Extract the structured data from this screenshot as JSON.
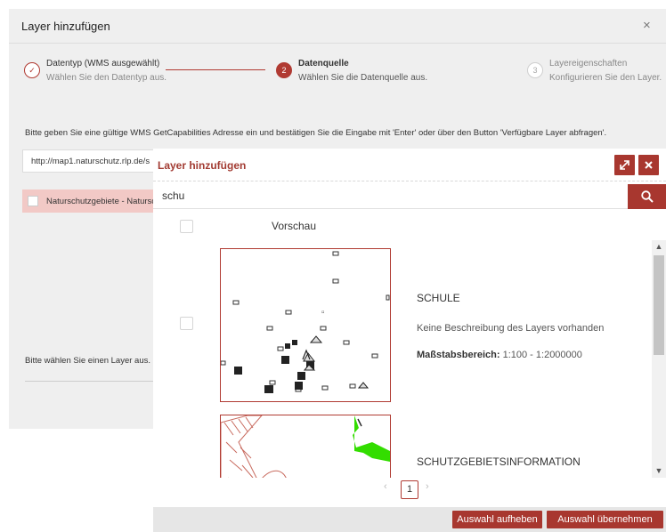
{
  "background_dialog": {
    "title": "Layer hinzufügen",
    "close_glyph": "×",
    "steps": [
      {
        "number": "✓",
        "title": "Datentyp (WMS ausgewählt)",
        "description": "Wählen Sie den Datentyp aus.",
        "state": "done"
      },
      {
        "number": "2",
        "title": "Datenquelle",
        "description": "Wählen Sie die Datenquelle aus.",
        "state": "active"
      },
      {
        "number": "3",
        "title": "Layereigenschaften",
        "description": "Konfigurieren Sie den Layer.",
        "state": "pending"
      }
    ],
    "instruction": "Bitte geben Sie eine gültige WMS GetCapabilities Adresse ein und bestätigen Sie die Eingabe mit 'Enter' oder über den Button 'Verfügbare Layer abfragen'.",
    "url_value": "http://map1.naturschutz.rlp.de/s",
    "layer_row_label": "Naturschutzgebiete - Natursc",
    "choose_prompt": "Bitte wählen Sie einen Layer aus."
  },
  "dialog": {
    "title": "Layer hinzufügen",
    "expand_icon": "expand-icon",
    "close_icon": "close-icon",
    "search": {
      "value": "schu",
      "icon": "search-icon"
    },
    "column_header": "Vorschau",
    "results": [
      {
        "name": "SCHULE",
        "description": "Keine Beschreibung des Layers vorhanden",
        "scale_label": "Maßstabsbereich:",
        "scale_value": "1:100 - 1:2000000"
      },
      {
        "name": "SCHUTZGEBIETSINFORMATION"
      }
    ],
    "pagination": {
      "prev": "‹",
      "current": "1",
      "next": "›"
    },
    "buttons": {
      "deselect": "Auswahl aufheben",
      "apply": "Auswahl übernehmen"
    }
  },
  "colors": {
    "accent": "#a8372f",
    "highlight_row": "#f2c9c6",
    "map_green": "#33dd00"
  }
}
